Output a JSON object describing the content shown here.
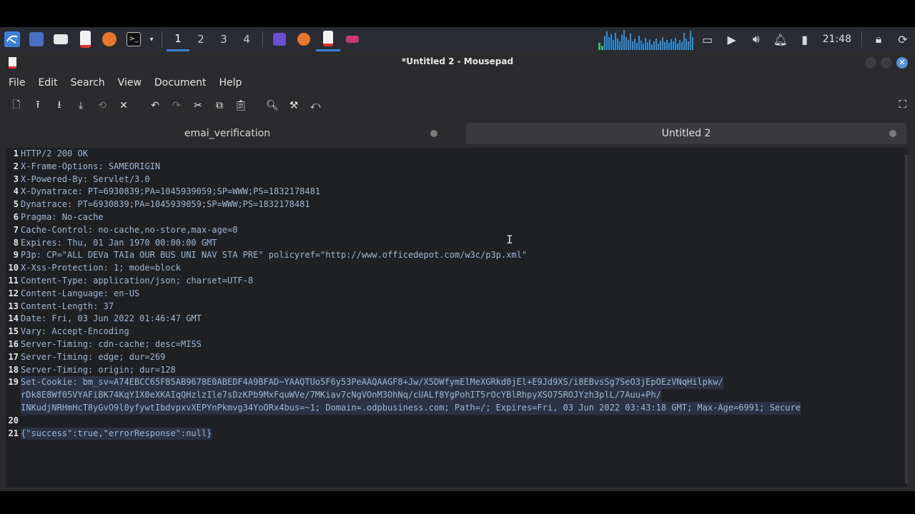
{
  "taskbar": {
    "workspaces": [
      "1",
      "2",
      "3",
      "4"
    ],
    "active_workspace_index": 0,
    "clock": "21:48",
    "icons": {
      "menu": "kali-menu-icon",
      "desktop": "desktop-icon",
      "files": "folder-icon",
      "text_editor": "text-editor-icon",
      "browser": "firefox-icon",
      "terminal": "terminal-icon",
      "volume": "volume-icon",
      "notifications": "bell-icon",
      "battery": "battery-icon",
      "lock": "lock-icon",
      "power": "power-icon"
    }
  },
  "window": {
    "title": "*Untitled 2 - Mousepad"
  },
  "menubar": [
    "File",
    "Edit",
    "Search",
    "View",
    "Document",
    "Help"
  ],
  "tabs": [
    {
      "label": "emai_verification",
      "active": false
    },
    {
      "label": "Untitled 2",
      "active": true
    }
  ],
  "editor": {
    "lines": [
      {
        "n": "1",
        "text": "HTTP/2 200 OK"
      },
      {
        "n": "2",
        "text": "X-Frame-Options: SAMEORIGIN"
      },
      {
        "n": "3",
        "text": "X-Powered-By: Servlet/3.0"
      },
      {
        "n": "4",
        "text": "X-Dynatrace: PT=6930839;PA=1045939059;SP=WWW;PS=1832178481"
      },
      {
        "n": "5",
        "text": "Dynatrace: PT=6930839;PA=1045939059;SP=WWW;PS=1832178481"
      },
      {
        "n": "6",
        "text": "Pragma: No-cache"
      },
      {
        "n": "7",
        "text": "Cache-Control: no-cache,no-store,max-age=0"
      },
      {
        "n": "8",
        "text": "Expires: Thu, 01 Jan 1970 00:00:00 GMT"
      },
      {
        "n": "9",
        "text": "P3p: CP=\"ALL DEVa TAIa OUR BUS UNI NAV STA PRE\" policyref=\"http://www.officedepot.com/w3c/p3p.xml\""
      },
      {
        "n": "10",
        "text": "X-Xss-Protection: 1; mode=block"
      },
      {
        "n": "11",
        "text": "Content-Type: application/json; charset=UTF-8"
      },
      {
        "n": "12",
        "text": "Content-Language: en-US"
      },
      {
        "n": "13",
        "text": "Content-Length: 37"
      },
      {
        "n": "14",
        "text": "Date: Fri, 03 Jun 2022 01:46:47 GMT"
      },
      {
        "n": "15",
        "text": "Vary: Accept-Encoding"
      },
      {
        "n": "16",
        "text": "Server-Timing: cdn-cache; desc=MISS"
      },
      {
        "n": "17",
        "text": "Server-Timing: edge; dur=269"
      },
      {
        "n": "18",
        "text": "Server-Timing: origin; dur=128"
      },
      {
        "n": "19",
        "text": "Set-Cookie: bm_sv=A74EBCC65FB5AB9678E0ABEDF4A9BFAD~YAAQTUo5F6y53PeAAQAAGF8+Jw/X5DWfymElMeXGRkd0jEl+E9Jd9XS/i8EBvsSg7SeO3jEpOEzVNqHilpkw/"
      },
      {
        "n": "",
        "text": "rDk8E8Wf05VYAFiBK74KqY1X0eXKAIqQHzlzIle7sDzKPb9MxFquWVe/7MKiav7cNgVOnM3OhNq/cUALf8YgPohIT5rOcYBlRhpyXSO75ROJYzh3plL/7Auu+Ph/"
      },
      {
        "n": "",
        "text": "INKudjNRHmHcT8yGvO9l0yfywtIbdvpxvXEPYnPkmvg34YoORx4bus=~1; Domain=.odpbusiness.com; Path=/; Expires=Fri, 03 Jun 2022 03:43:18 GMT; Max-Age=6991; Secure"
      },
      {
        "n": "20",
        "text": ""
      },
      {
        "n": "21",
        "text": "{\"success\":true,\"errorResponse\":null}"
      }
    ]
  },
  "colors": {
    "accent": "#3d7fd6",
    "editor_bg": "#1f2024",
    "code_text": "#9fb8d4"
  }
}
